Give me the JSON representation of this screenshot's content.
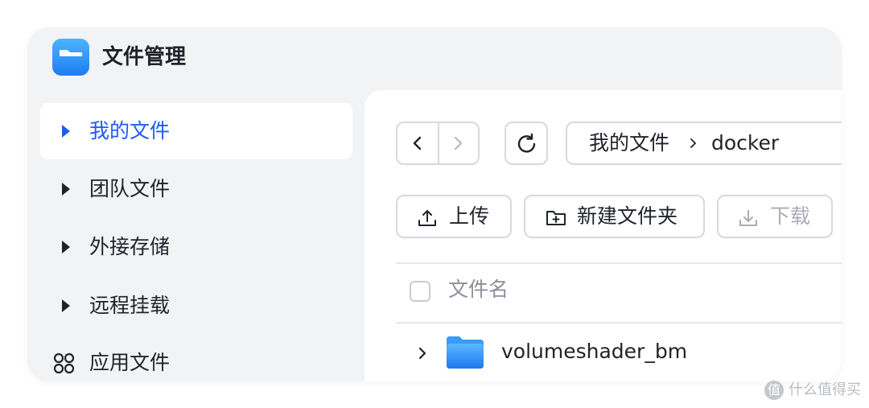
{
  "app": {
    "title": "文件管理",
    "icon": "folder-app-icon"
  },
  "sidebar": {
    "items": [
      {
        "label": "我的文件",
        "icon": "caret-right-icon",
        "active": true
      },
      {
        "label": "团队文件",
        "icon": "caret-right-icon",
        "active": false
      },
      {
        "label": "外接存储",
        "icon": "caret-right-icon",
        "active": false
      },
      {
        "label": "远程挂载",
        "icon": "caret-right-icon",
        "active": false
      },
      {
        "label": "应用文件",
        "icon": "apps-grid-icon",
        "active": false
      }
    ]
  },
  "toolbar": {
    "back_icon": "chevron-left-icon",
    "forward_icon": "chevron-right-icon",
    "refresh_icon": "refresh-icon",
    "breadcrumb": [
      "我的文件",
      "docker"
    ],
    "breadcrumb_separator_icon": "chevron-right-icon",
    "actions": [
      {
        "label": "上传",
        "icon": "upload-icon",
        "disabled": false
      },
      {
        "label": "新建文件夹",
        "icon": "new-folder-icon",
        "disabled": false
      },
      {
        "label": "下载",
        "icon": "download-icon",
        "disabled": true
      }
    ]
  },
  "table": {
    "column_header": "文件名",
    "rows": [
      {
        "name": "volumeshader_bm",
        "type": "folder"
      }
    ]
  },
  "watermark": {
    "icon_text": "值",
    "text": "什么值得买"
  },
  "colors": {
    "accent": "#1d5cf5",
    "window_bg": "#f2f3f5",
    "panel_bg": "#ffffff",
    "border": "#d7d9de",
    "muted_text": "#8a8f99"
  }
}
